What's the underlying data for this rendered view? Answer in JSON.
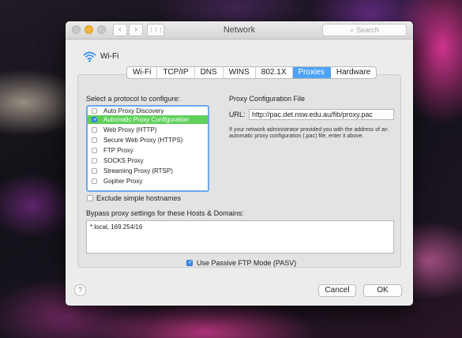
{
  "window": {
    "title": "Network",
    "search_placeholder": "Search"
  },
  "toolbar": {
    "back_glyph": "‹",
    "forward_glyph": "›",
    "grid_glyph": "⋮⋮⋮"
  },
  "interface": {
    "name": "Wi-Fi",
    "icon": "wifi-icon"
  },
  "tabs": [
    {
      "label": "Wi-Fi",
      "active": false
    },
    {
      "label": "TCP/IP",
      "active": false
    },
    {
      "label": "DNS",
      "active": false
    },
    {
      "label": "WINS",
      "active": false
    },
    {
      "label": "802.1X",
      "active": false
    },
    {
      "label": "Proxies",
      "active": true
    },
    {
      "label": "Hardware",
      "active": false
    }
  ],
  "proxies": {
    "protocol_heading": "Select a protocol to configure:",
    "protocols": [
      {
        "label": "Auto Proxy Discovery",
        "checked": false,
        "selected": false
      },
      {
        "label": "Automatic Proxy Configuration",
        "checked": true,
        "selected": true
      },
      {
        "label": "Web Proxy (HTTP)",
        "checked": false,
        "selected": false
      },
      {
        "label": "Secure Web Proxy (HTTPS)",
        "checked": false,
        "selected": false
      },
      {
        "label": "FTP Proxy",
        "checked": false,
        "selected": false
      },
      {
        "label": "SOCKS Proxy",
        "checked": false,
        "selected": false
      },
      {
        "label": "Streaming Proxy (RTSP)",
        "checked": false,
        "selected": false
      },
      {
        "label": "Gopher Proxy",
        "checked": false,
        "selected": false
      }
    ],
    "config_heading": "Proxy Configuration File",
    "url_label": "URL:",
    "url_value": "http://pac.det.nsw.edu.au/fib/proxy.pac",
    "help_text": "If your network administrator provided you with the address of an automatic proxy configuration (.pac) file, enter it above.",
    "exclude_label": "Exclude simple hostnames",
    "exclude_checked": false,
    "bypass_label": "Bypass proxy settings for these Hosts & Domains:",
    "bypass_value": "*.local, 169.254/16",
    "passive_ftp_label": "Use Passive FTP Mode (PASV)",
    "passive_ftp_checked": true
  },
  "footer": {
    "help_label": "?",
    "cancel_label": "Cancel",
    "ok_label": "OK"
  },
  "colors": {
    "accent": "#4fa3f7",
    "selected_row": "#5fd05a",
    "checkbox_on": "#3b8cf0"
  }
}
